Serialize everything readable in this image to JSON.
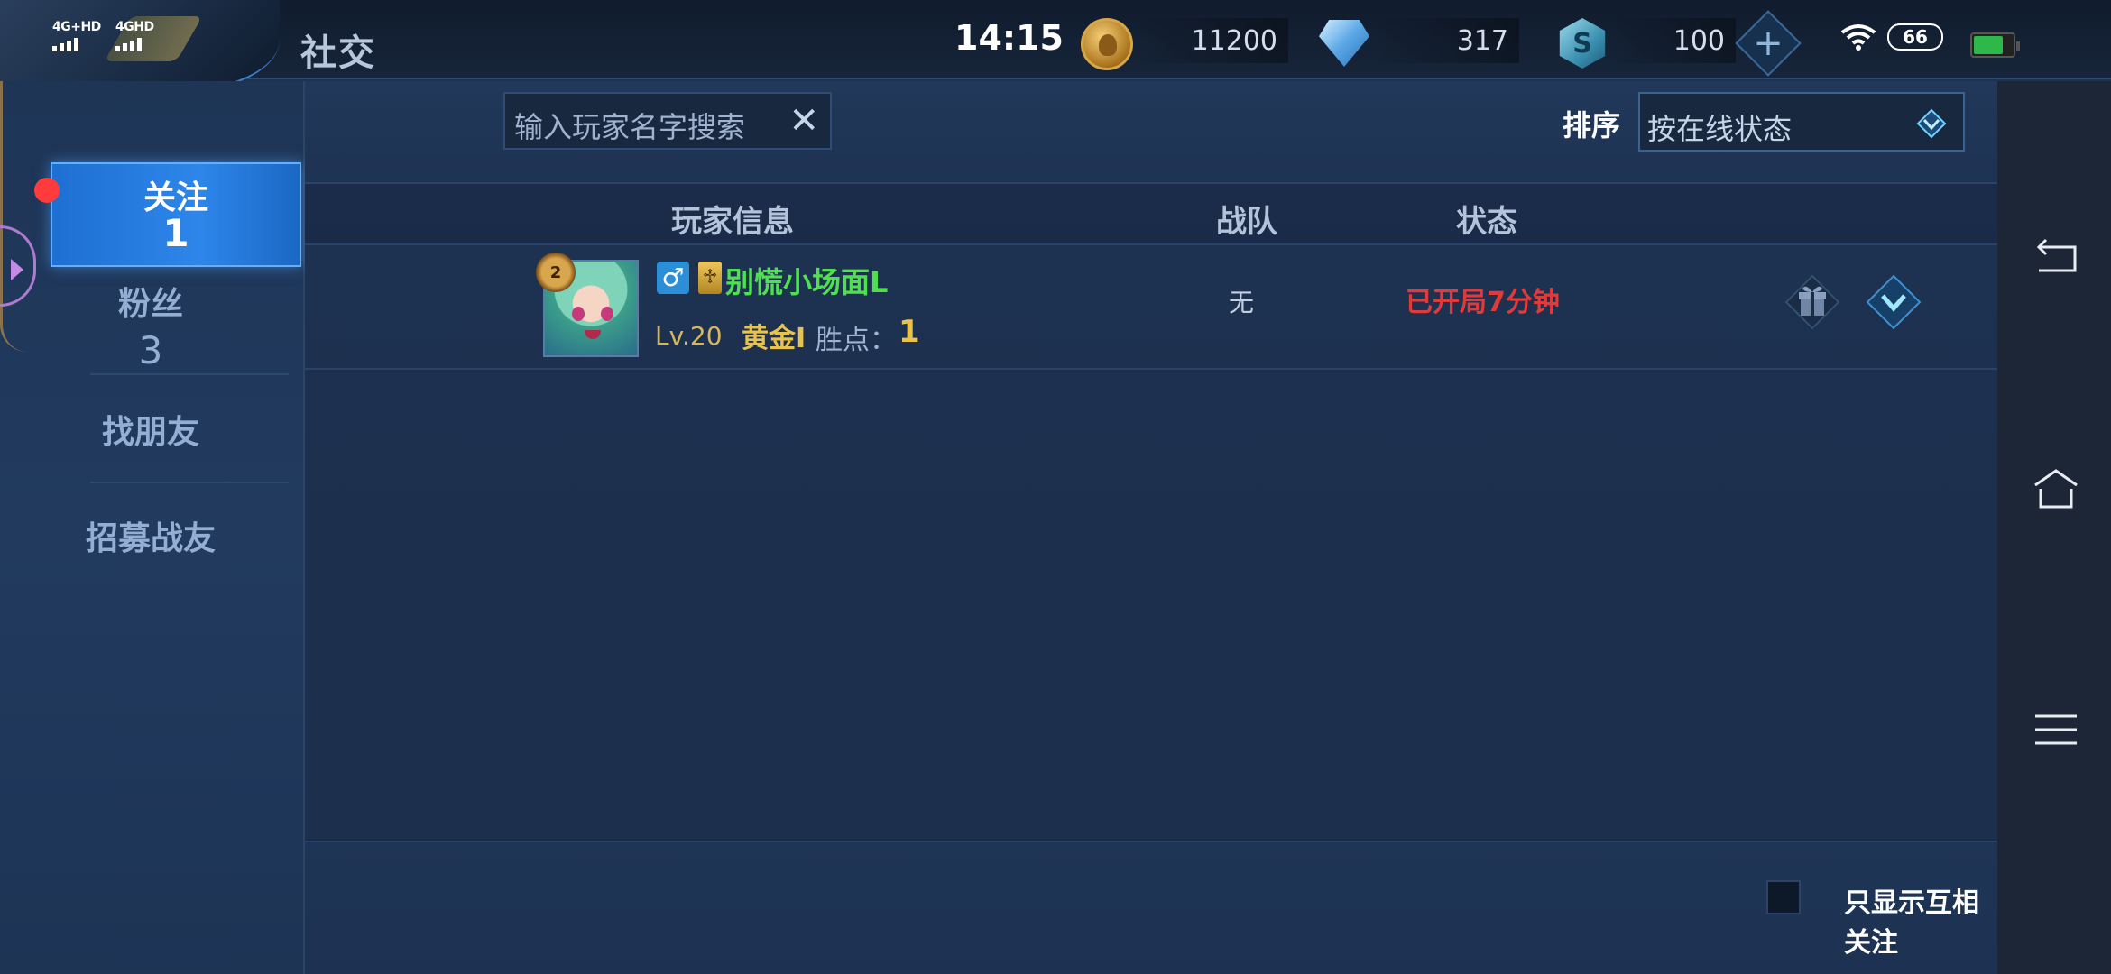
{
  "status_bar": {
    "signal1": "4G+HD",
    "signal2": "4GHD",
    "time": "14:15",
    "battery_pct": "66"
  },
  "page": {
    "title": "社交"
  },
  "currencies": {
    "gold": "11200",
    "diamond": "317",
    "token": "100",
    "add_label": "+"
  },
  "sidebar": {
    "follow": {
      "label": "关注",
      "count": "1"
    },
    "fans": {
      "label": "粉丝",
      "count": "3"
    },
    "find_friends": "找朋友",
    "recruit": "招募战友"
  },
  "search": {
    "placeholder": "输入玩家名字搜索",
    "clear_icon": "close-icon"
  },
  "sort": {
    "label": "排序",
    "value": "按在线状态"
  },
  "table": {
    "headers": {
      "player_info": "玩家信息",
      "team": "战队",
      "status": "状态"
    },
    "rows": [
      {
        "gender": "♂",
        "name": "别慌小场面L",
        "level": "Lv.20",
        "rank": "黄金I",
        "wins_label": "胜点：",
        "wins": "1",
        "team": "无",
        "status": "已开局7分钟",
        "rank_badge": "2"
      }
    ]
  },
  "footer": {
    "mutual_only": "只显示互相关注"
  },
  "colors": {
    "accent": "#2e86ea",
    "status_red": "#e13a3a",
    "name_green": "#4ee04e",
    "gold": "#e8c24a"
  }
}
